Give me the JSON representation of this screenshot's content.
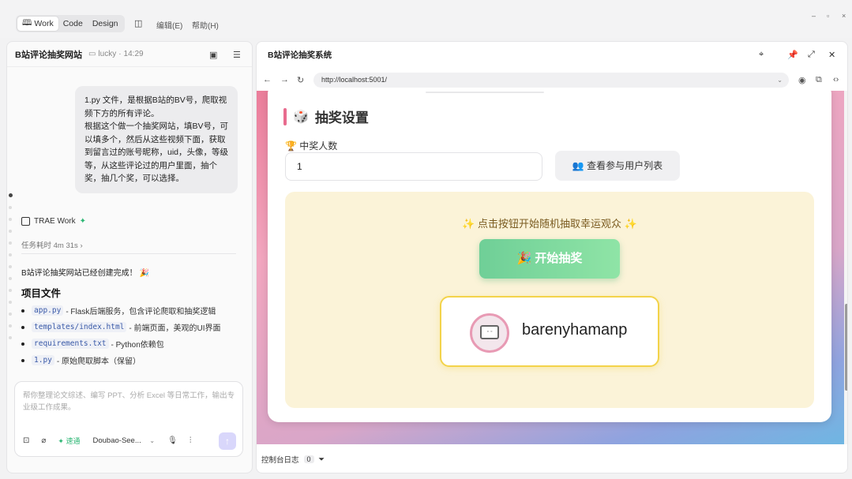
{
  "topbar": {
    "modes": [
      "Work",
      "Code",
      "Design"
    ],
    "menus": [
      "编辑(E)",
      "帮助(H)"
    ],
    "window_controls": [
      "–",
      "▫",
      "×"
    ]
  },
  "left": {
    "title": "B站评论抽奖网站",
    "user": "lucky",
    "time": "14:29",
    "user_message": "1.py 文件，是根据B站的BV号，爬取视频下方的所有评论。\n根据这个做一个抽奖网站，填BV号，可以填多个，然后从这些视频下面，获取到留言过的账号昵称，uid，头像，等级等，从这些评论过的用户里面，抽个奖，抽几个奖，可以选择。",
    "agent_name": "TRAE Work",
    "task_time": "任务耗时 4m 31s",
    "done_message": "B站评论抽奖网站已经创建完成！",
    "project_title": "项目文件",
    "files": [
      {
        "name": "app.py",
        "desc": "- Flask后端服务，包含评论爬取和抽奖逻辑"
      },
      {
        "name": "templates/index.html",
        "desc": "- 前端页面，美观的UI界面"
      },
      {
        "name": "requirements.txt",
        "desc": "- Python依赖包"
      },
      {
        "name": "1.py",
        "desc": "- 原始爬取脚本（保留）"
      }
    ],
    "input_placeholder": "帮你整理论文综述、编写 PPT、分析 Excel 等日常工作，输出专业级工作成果。",
    "speed_label": "速通",
    "model_label": "Doubao-See..."
  },
  "right": {
    "title": "B站评论抽奖系统",
    "url": "http://localhost:5001/",
    "section_title": "抽奖设置",
    "winner_count_label": "中奖人数",
    "winner_count_value": "1",
    "view_users_label": "查看参与用户列表",
    "hint": "点击按钮开始随机抽取幸运观众",
    "start_button": "开始抽奖",
    "winner_name": "barenyhamanp",
    "console_label": "控制台日志",
    "console_count": "0"
  }
}
